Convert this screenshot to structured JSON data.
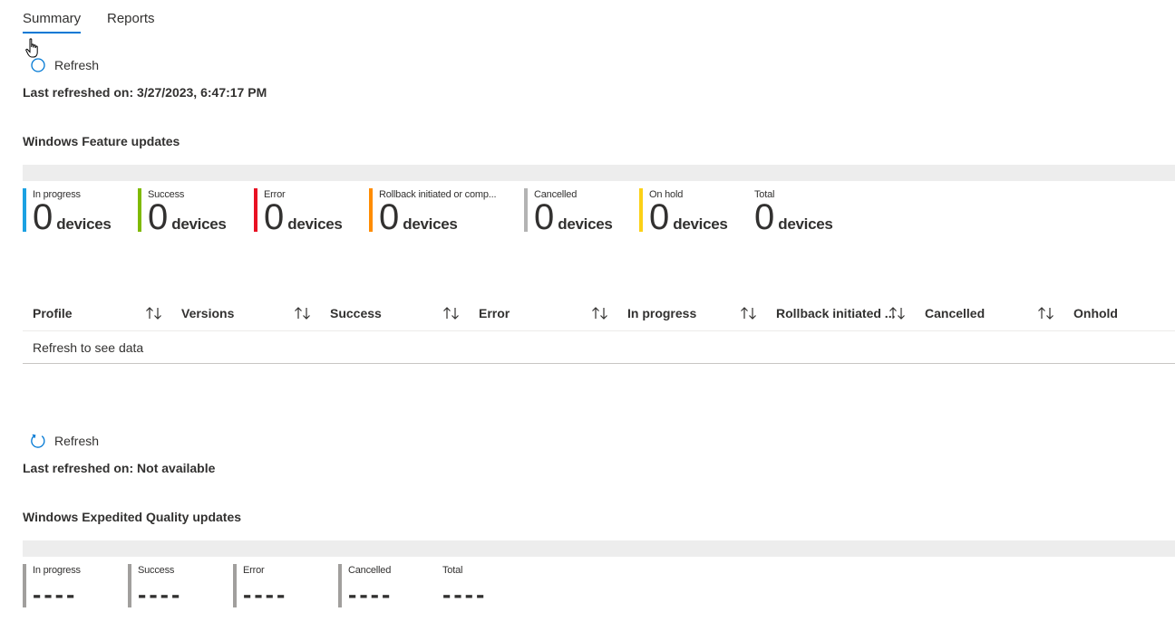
{
  "tabs": [
    {
      "label": "Summary",
      "active": true
    },
    {
      "label": "Reports",
      "active": false
    }
  ],
  "feature_section": {
    "refresh_label": "Refresh",
    "last_refreshed": "Last refreshed on: 3/27/2023, 6:47:17 PM",
    "title": "Windows Feature updates",
    "tiles": [
      {
        "label": "In progress",
        "value": "0",
        "unit": "devices",
        "color": "#1ba1e2"
      },
      {
        "label": "Success",
        "value": "0",
        "unit": "devices",
        "color": "#7fba00"
      },
      {
        "label": "Error",
        "value": "0",
        "unit": "devices",
        "color": "#e81123"
      },
      {
        "label": "Rollback initiated or comp...",
        "value": "0",
        "unit": "devices",
        "color": "#ff8c00"
      },
      {
        "label": "Cancelled",
        "value": "0",
        "unit": "devices",
        "color": "#b3b3b3"
      },
      {
        "label": "On hold",
        "value": "0",
        "unit": "devices",
        "color": "#fcd116"
      },
      {
        "label": "Total",
        "value": "0",
        "unit": "devices",
        "color": ""
      }
    ],
    "table": {
      "columns": [
        "Profile",
        "Versions",
        "Success",
        "Error",
        "In progress",
        "Rollback initiated ...",
        "Cancelled",
        "Onhold"
      ],
      "empty_message": "Refresh to see data"
    }
  },
  "quality_section": {
    "refresh_label": "Refresh",
    "last_refreshed": "Last refreshed on: Not available",
    "title": "Windows Expedited Quality updates",
    "tiles": [
      {
        "label": "In progress",
        "value": "----",
        "color": "#a19f9d"
      },
      {
        "label": "Success",
        "value": "----",
        "color": "#a19f9d"
      },
      {
        "label": "Error",
        "value": "----",
        "color": "#a19f9d"
      },
      {
        "label": "Cancelled",
        "value": "----",
        "color": "#a19f9d"
      },
      {
        "label": "Total",
        "value": "----",
        "color": ""
      }
    ]
  }
}
